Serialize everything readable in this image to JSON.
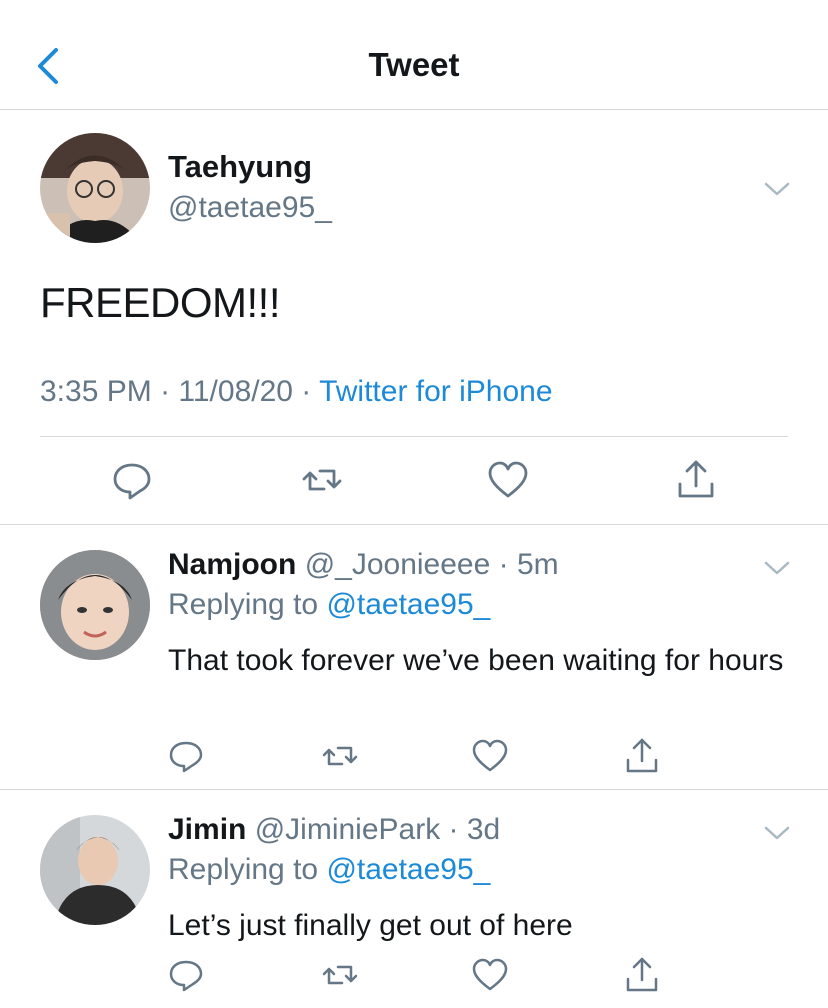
{
  "header": {
    "title": "Tweet",
    "accent_color": "#1d8ad8"
  },
  "main_tweet": {
    "author_name": "Taehyung",
    "author_handle": "@taetae95_",
    "text": "FREEDOM!!!",
    "time": "3:35 PM",
    "separator1": " · ",
    "date": "11/08/20",
    "separator2": " · ",
    "source": "Twitter for iPhone",
    "actions": [
      "reply-icon",
      "retweet-icon",
      "like-icon",
      "share-icon"
    ]
  },
  "replies": [
    {
      "author_name": "Namjoon",
      "author_handle": "@_Joonieeee",
      "separator": " · ",
      "age": "5m",
      "replying_label": "Replying to ",
      "replying_to": "@taetae95_",
      "text": "That took forever we’ve been waiting for hours"
    },
    {
      "author_name": "Jimin",
      "author_handle": "@JiminiePark",
      "separator": " · ",
      "age": "3d",
      "replying_label": "Replying to ",
      "replying_to": "@taetae95_",
      "text": "Let’s just finally get out of here"
    }
  ]
}
